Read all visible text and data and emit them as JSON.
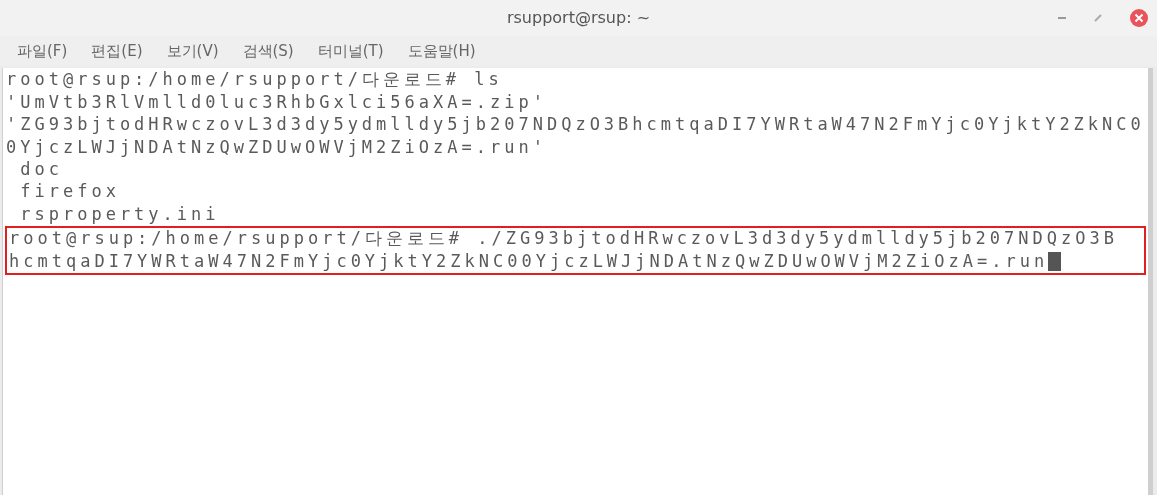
{
  "window": {
    "title": "rsupport@rsup: ~"
  },
  "menu": [
    "파일(F)",
    "편집(E)",
    "보기(V)",
    "검색(S)",
    "터미널(T)",
    "도움말(H)"
  ],
  "terminal": {
    "lines": [
      {
        "text": "root@rsup:/home/rsupport/다운로드# ls"
      },
      {
        "text": "'UmVtb3RlVmlld0luc3RhbGxlci56aXA=.zip'"
      },
      {
        "text": "'ZG93bjtodHRwczovL3d3dy5ydmlldy5jb207NDQzO3BhcmtqaDI7YWRtaW47N2FmYjc0YjktY2ZkNC0"
      },
      {
        "text": "0YjczLWJjNDAtNzQwZDUwOWVjM2ZiOzA=.run'"
      },
      {
        "text": " doc"
      },
      {
        "text": " firefox"
      },
      {
        "text": " rsproperty.ini"
      }
    ],
    "highlighted_lines": [
      {
        "text": "root@rsup:/home/rsupport/다운로드# ./ZG93bjtodHRwczovL3d3dy5ydmlldy5jb207NDQzO3B"
      },
      {
        "text": "hcmtqaDI7YWRtaW47N2FmYjc0YjktY2ZkNC00YjczLWJjNDAtNzQwZDUwOWVjM2ZiOzA=.run",
        "cursor": true
      }
    ]
  }
}
